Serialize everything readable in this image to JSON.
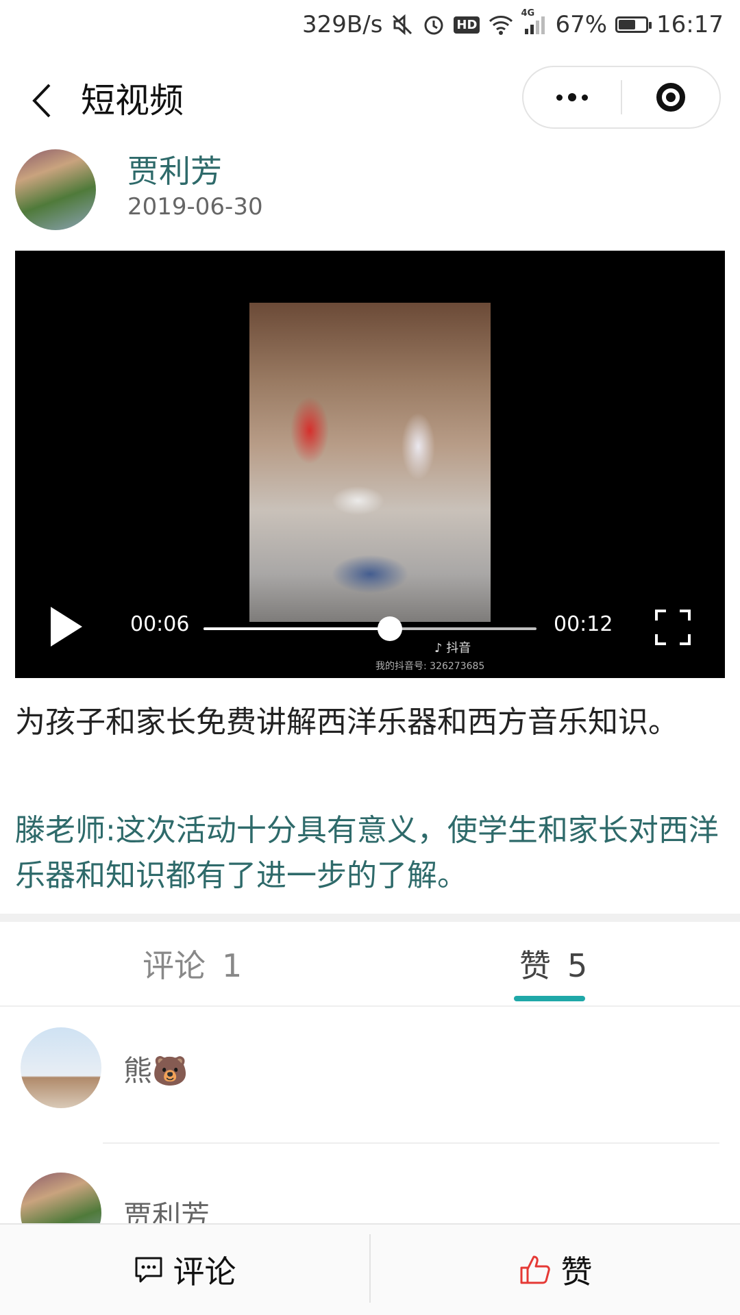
{
  "status_bar": {
    "net_speed": "329B/s",
    "hd_label": "HD",
    "network_type": "4G",
    "battery": "67%",
    "battery_level": 0.67,
    "time": "16:17"
  },
  "header": {
    "title": "短视频"
  },
  "post": {
    "author": "贾利芳",
    "date": "2019-06-30",
    "video": {
      "current_time": "00:06",
      "total_time": "00:12",
      "progress": 0.56,
      "watermark_app": "抖音",
      "watermark_id": "我的抖音号: 326273685"
    },
    "description": "为孩子和家长免费讲解西洋乐器和西方音乐知识。",
    "teacher_comment": " 滕老师:这次活动十分具有意义，使学生和家长对西洋乐器和知识都有了进一步的了解。"
  },
  "tabs": [
    {
      "label": "评论",
      "count": "1"
    },
    {
      "label": "赞",
      "count": "5"
    }
  ],
  "likes": [
    {
      "name": "熊🐻"
    },
    {
      "name": "贾利芳"
    }
  ],
  "bottom_bar": {
    "comment_label": "评论",
    "like_label": "赞"
  },
  "colors": {
    "accent": "#1fa8a8",
    "name_teal": "#2e6a6a",
    "like_red": "#e53935"
  }
}
